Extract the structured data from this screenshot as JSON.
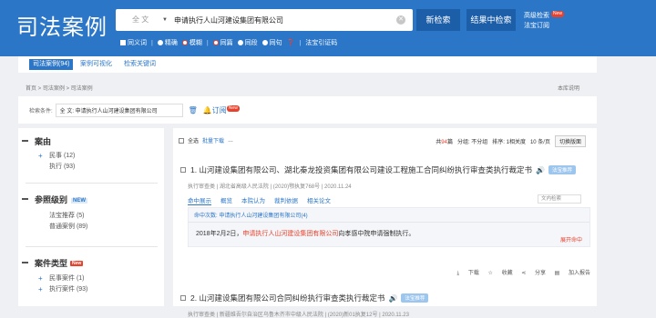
{
  "header": {
    "logo": "司法案例",
    "scope": "全 文",
    "query": "申请执行人山河建设集团有限公司",
    "new_search": "新检索",
    "result_search": "结果中检索",
    "advanced": "高级检索",
    "new_badge": "New",
    "subscribe": "法宝订阅",
    "options": [
      "同义词",
      "精确",
      "模糊",
      "同篇",
      "同段",
      "同句",
      "法宝引证码"
    ]
  },
  "tabs": [
    "司法案例(94)",
    "案例可视化",
    "检索关键词"
  ],
  "breadcrumb": "首页 > 司法案例 > 司法案例",
  "library_note": "本库说明",
  "condition": {
    "label": "检索条件:",
    "value": "全 文:  申请执行人山河建设集团有限公司",
    "subscribe": "订阅",
    "new_badge": "New"
  },
  "sidebar": {
    "sections": [
      {
        "title": "案由",
        "items": [
          {
            "label": "民事 (12)",
            "plus": true
          },
          {
            "label": "执行 (93)",
            "plus": false
          }
        ]
      },
      {
        "title": "参照级别",
        "badge": "NEW",
        "items": [
          {
            "label": "法宝推荐 (5)",
            "plus": false
          },
          {
            "label": "普通案例 (89)",
            "plus": false
          }
        ]
      },
      {
        "title": "案件类型",
        "badge": "New",
        "items": [
          {
            "label": "民事案件 (1)",
            "plus": true
          },
          {
            "label": "执行案件 (93)",
            "plus": true
          }
        ]
      }
    ]
  },
  "toolbar": {
    "select_all": "全选",
    "batch_download": "批量下载",
    "more": "…",
    "total_prefix": "共",
    "total_count": "94",
    "total_suffix": "篇",
    "group": "分组: 不分组",
    "sort": "排序: 1相关度",
    "per_page": "10 条/页",
    "switch_view": "切换版面"
  },
  "cases": [
    {
      "title": "1. 山河建设集团有限公司、湖北秦龙投资集团有限公司建设工程施工合同纠纷执行审查类执行裁定书",
      "tag": "法宝推荐",
      "meta": "执行审查类  |  湖北省高级人民法院  |  (2020)鄂执复768号  |  2020.11.24",
      "tabs": [
        "命中展示",
        "概览",
        "本院认为",
        "裁判依据",
        "相关论文"
      ],
      "in_doc_search": "文内检索",
      "hit_count_line": "命中次数: 申请执行人山河建设集团有限公司(4)",
      "hit_pre": "2018年2月2日，",
      "hit_highlight": "申请执行人山河建设集团有限公司",
      "hit_post": "向孝感中院申请强制执行。",
      "expand": "展开命中",
      "actions": [
        "下载",
        "收藏",
        "分享",
        "加入报告"
      ]
    },
    {
      "title": "2. 山河建设集团有限公司合同纠纷执行审查类执行裁定书",
      "tag": "法宝推荐",
      "meta": "执行审查类  |  新疆维吾尔自治区乌鲁木齐市中级人民法院  |  (2020)新01执复12号  |  2020.11.23"
    }
  ],
  "colors": {
    "header": "#2b76c7",
    "accent_red": "#e8412c",
    "link": "#2b76c7"
  }
}
